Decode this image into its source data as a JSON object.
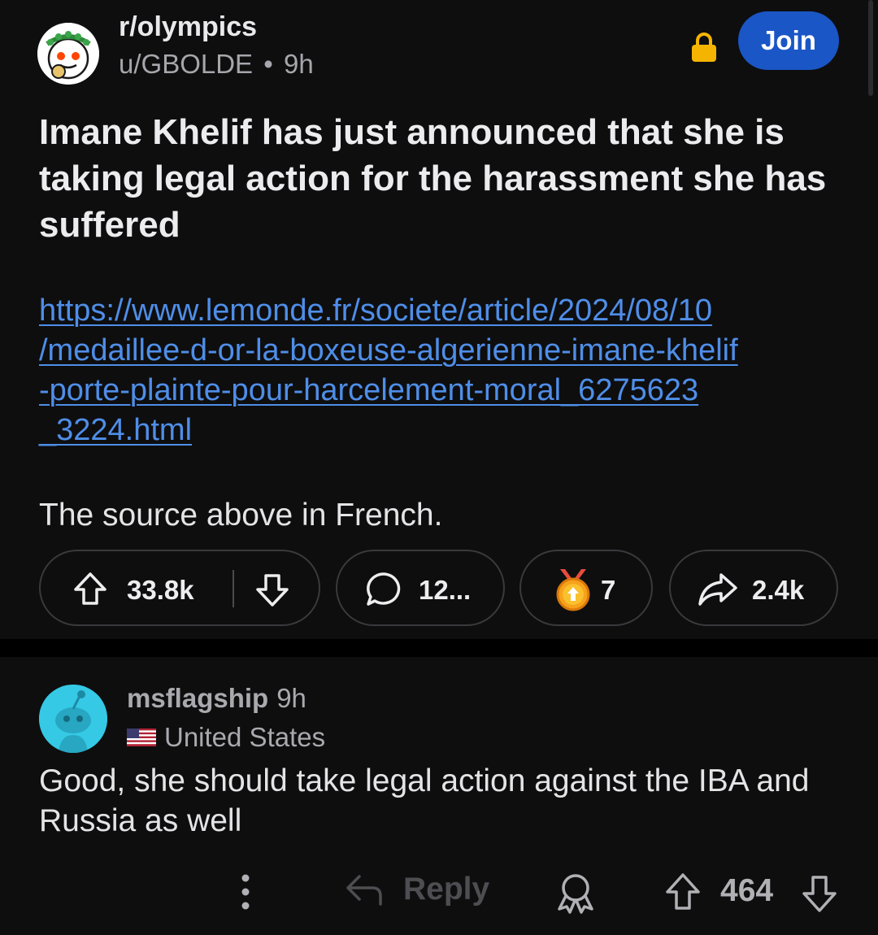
{
  "post": {
    "subreddit": "r/olympics",
    "author": "u/GBOLDE",
    "separator": "•",
    "age": "9h",
    "join_label": "Join",
    "title": "Imane Khelif has just announced that she is taking legal action for the harassment she has suffered",
    "link_lines": [
      "https://www.lemonde.fr/societe/article/2024/08/10",
      "/medaillee-d-or-la-boxeuse-algerienne-imane-khelif",
      "-porte-plainte-pour-harcelement-moral_6275623",
      "_3224.html"
    ],
    "body": "The source above in French."
  },
  "actions": {
    "upvotes": "33.8k",
    "comments": "12...",
    "awards": "7",
    "shares": "2.4k"
  },
  "comment": {
    "author": "msflagship",
    "age": "9h",
    "flair": "United States",
    "body": "Good, she should take legal action against the IBA and Russia as well",
    "reply_label": "Reply",
    "score": "464"
  },
  "icons": {
    "lock": "lock-icon",
    "upvote": "upvote-arrow-icon",
    "downvote": "downvote-arrow-icon",
    "comment": "speech-bubble-icon",
    "award": "gold-medal-icon",
    "share": "share-arrow-icon",
    "more": "vertical-ellipsis-icon",
    "reply": "reply-arrow-icon",
    "give_award": "award-ribbon-icon"
  },
  "colors": {
    "background": "#0e0e0f",
    "join_button": "#1a56c6",
    "link": "#4f8ee8",
    "lock": "#f5b400",
    "comment_avatar": "#35c9e6"
  }
}
